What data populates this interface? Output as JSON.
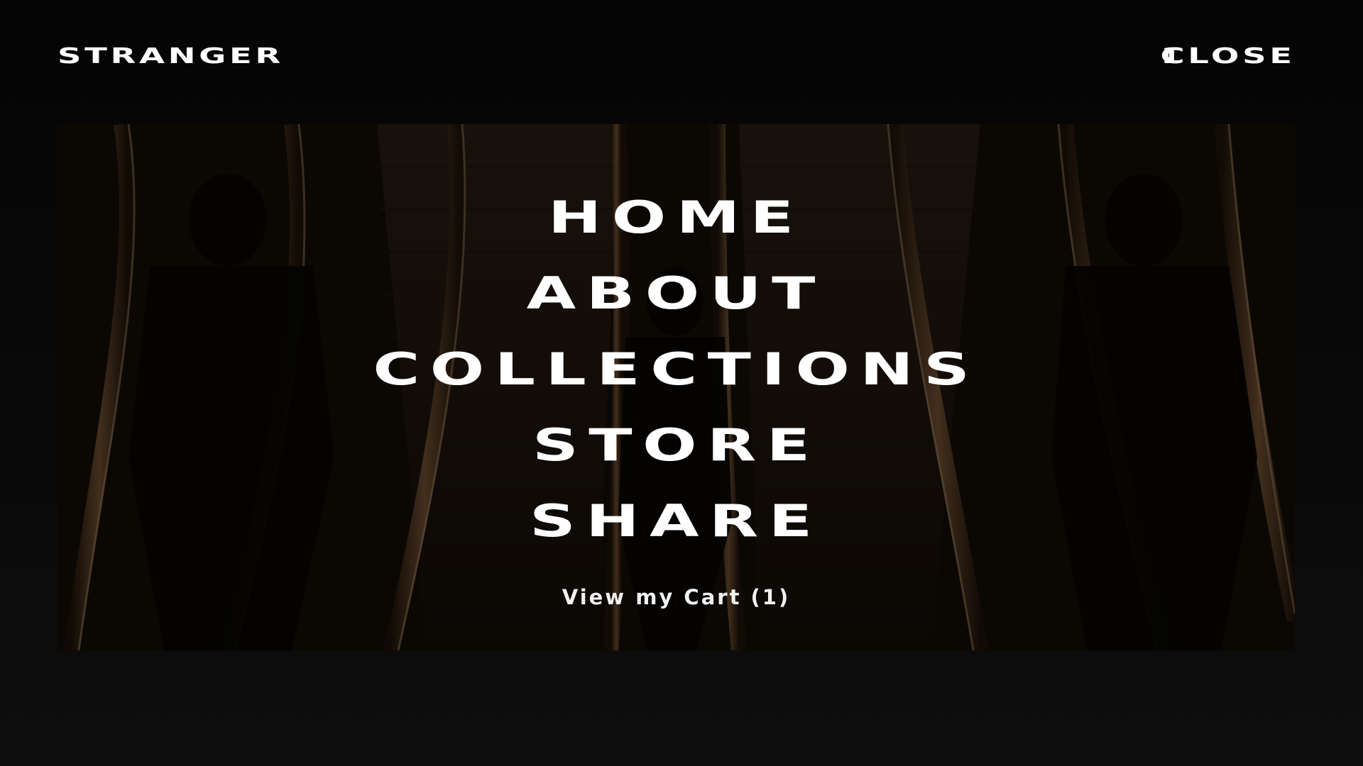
{
  "header": {
    "logo": "STRANGER",
    "cart_count": "1",
    "close_label": "CLOSE"
  },
  "menu": {
    "items": [
      {
        "label": "HOME"
      },
      {
        "label": "ABOUT"
      },
      {
        "label": "COLLECTIONS"
      },
      {
        "label": "STORE"
      },
      {
        "label": "SHARE"
      }
    ],
    "cart_link": "View my Cart (1)"
  },
  "colors": {
    "background": "#050505",
    "text": "#ffffff",
    "hero_tint": "#120c07",
    "escalator_accent": "#a8774a"
  }
}
